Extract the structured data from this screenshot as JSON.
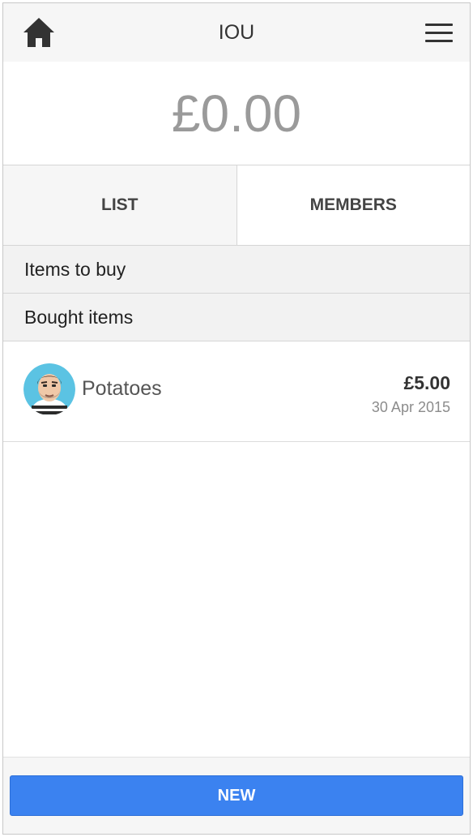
{
  "header": {
    "title": "IOU",
    "home_icon": "home-icon",
    "menu_icon": "hamburger-menu-icon"
  },
  "balance": {
    "amount": "£0.00"
  },
  "tabs": [
    {
      "label": "LIST",
      "active": true
    },
    {
      "label": "MEMBERS",
      "active": false
    }
  ],
  "sections": {
    "items_to_buy": "Items to buy",
    "bought_items": "Bought items"
  },
  "items": [
    {
      "name": "Potatoes",
      "price": "£5.00",
      "date": "30 Apr 2015",
      "avatar_icon": "user-avatar-icon"
    }
  ],
  "footer": {
    "new_label": "NEW"
  },
  "colors": {
    "accent": "#3b82f0",
    "header_bg": "#f6f6f6",
    "balance_text": "#9a9a9a"
  }
}
